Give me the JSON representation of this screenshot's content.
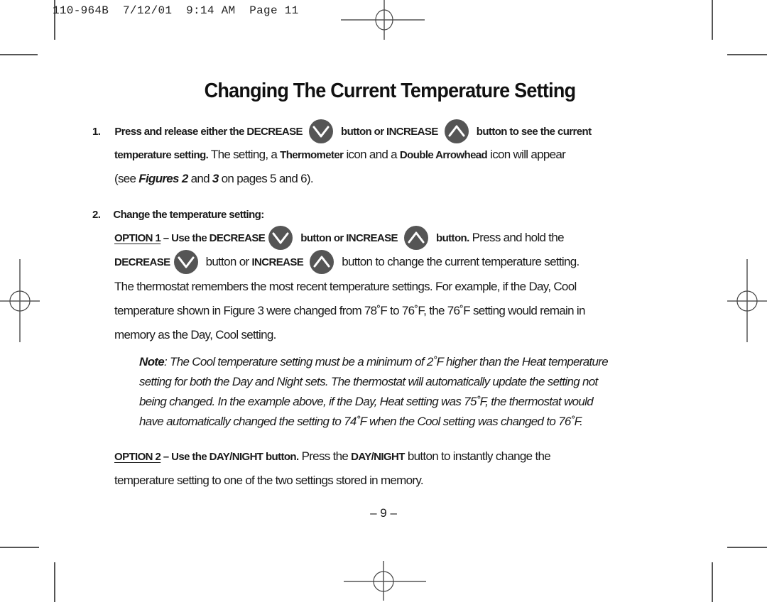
{
  "header": {
    "slug": "110-964B  7/12/01  9:14 AM  Page 11"
  },
  "title": "Changing The Current Temperature Setting",
  "icons": {
    "decrease": "chevron-down-button",
    "increase": "chevron-up-button"
  },
  "colors": {
    "button_fill": "#555555",
    "button_glyph": "#ffffff",
    "crop_marks": "#555555"
  },
  "step1": {
    "number": "1.",
    "l1_a": "Press and release either the DECREASE",
    "l1_b": "button or INCREASE",
    "l1_c": "button to see the current",
    "l2_bold": "temperature setting.",
    "l2_a": " The setting, a ",
    "l2_thermo": "Thermometer",
    "l2_b": " icon and a ",
    "l2_arrow": "Double Arrowhead",
    "l2_c": " icon will appear",
    "l3_a": "(see ",
    "l3_fig": "Figures 2",
    "l3_b": " and ",
    "l3_3": "3",
    "l3_c": " on pages 5 and 6)."
  },
  "step2": {
    "number": "2.",
    "heading": "Change the temperature setting:",
    "opt1_label": "OPTION 1",
    "opt1_a": " – Use the DECREASE",
    "opt1_b": "button or INCREASE",
    "opt1_c": "button.",
    "opt1_d": " Press and hold the",
    "l2_dec": "DECREASE",
    "l2_a": "button or ",
    "l2_inc": "INCREASE",
    "l2_b": "button to change the current temperature setting.",
    "p1": "The thermostat remembers the most recent temperature settings. For example, if the Day, Cool",
    "p2": "temperature shown in Figure 3 were changed from 78˚F to 76˚F, the 76˚F setting would remain in",
    "p3": "memory as the Day, Cool setting.",
    "note_label": "Note",
    "note_1": ": The Cool temperature setting must be a minimum of 2˚F higher than the Heat temperature",
    "note_2": "setting for both the Day and Night sets. The thermostat will automatically update the setting not",
    "note_3": "being changed. In the example above, if the Day, Heat setting was 75˚F, the thermostat would",
    "note_4": "have automatically changed the setting to 74˚F when the Cool setting was changed to 76˚F.",
    "opt2_label": "OPTION 2",
    "opt2_a": " – Use the DAY/NIGHT button.",
    "opt2_b": " Press the ",
    "opt2_c": "DAY/NIGHT",
    "opt2_d": " button to instantly change the",
    "opt2_l2": "temperature setting to one of the two settings stored in memory."
  },
  "page_number": "– 9 –"
}
